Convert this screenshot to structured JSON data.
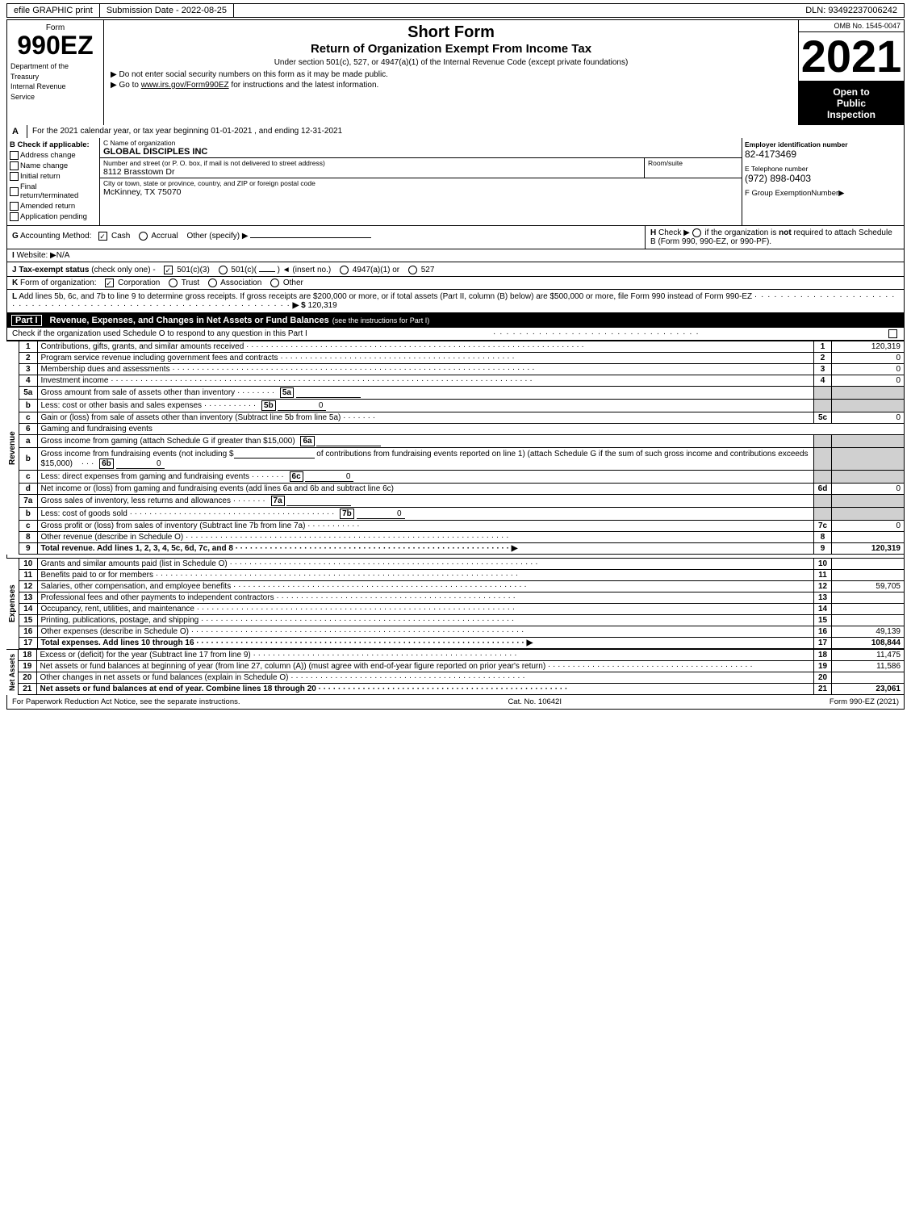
{
  "topBar": {
    "efileLabel": "efile GRAPHIC print",
    "submissionLabel": "Submission Date - 2022-08-25",
    "dlnLabel": "DLN: 93492237006242"
  },
  "header": {
    "formNumber": "990EZ",
    "deptLine1": "Department of the",
    "deptLine2": "Treasury",
    "deptLine3": "Internal Revenue",
    "deptLine4": "Service",
    "titleShortForm": "Short Form",
    "titleReturn": "Return of Organization Exempt From Income Tax",
    "titleUnder": "Under section 501(c), 527, or 4947(a)(1) of the Internal Revenue Code (except private foundations)",
    "noteSSN": "▶ Do not enter social security numbers on this form as it may be made public.",
    "noteGo": "▶ Go to",
    "noteLink": "www.irs.gov/Form990EZ",
    "noteLinkSuffix": "for instructions and the latest information.",
    "ombLabel": "OMB No. 1545-0047",
    "year": "2021",
    "openTitle": "Open to",
    "openPublic": "Public",
    "openInspection": "Inspection"
  },
  "sectionA": {
    "label": "A",
    "text": "For the 2021 calendar year, or tax year beginning 01-01-2021 , and ending 12-31-2021"
  },
  "sectionB": {
    "label": "B",
    "checkLabel": "Check if applicable:",
    "checks": [
      {
        "id": "address",
        "label": "Address change",
        "checked": false
      },
      {
        "id": "name",
        "label": "Name change",
        "checked": false
      },
      {
        "id": "initial",
        "label": "Initial return",
        "checked": false
      },
      {
        "id": "final",
        "label": "Final return/terminated",
        "checked": false
      },
      {
        "id": "amended",
        "label": "Amended return",
        "checked": false
      },
      {
        "id": "pending",
        "label": "Application pending",
        "checked": false
      }
    ]
  },
  "sectionC": {
    "label": "C",
    "nameLabel": "Name of organization",
    "nameValue": "GLOBAL DISCIPLES INC",
    "addressLabel": "Number and street (or P. O. box, if mail is not delivered to street address)",
    "addressValue": "8112 Brasstown Dr",
    "roomLabel": "Room/suite",
    "roomValue": "",
    "cityLabel": "City or town, state or province, country, and ZIP or foreign postal code",
    "cityValue": "McKinney, TX  75070"
  },
  "sectionD": {
    "label": "D",
    "einLabel": "Employer identification number",
    "einValue": "82-4173469",
    "phoneLabel": "E Telephone number",
    "phoneValue": "(972) 898-0403",
    "groupLabel": "F Group Exemption",
    "groupLabel2": "Number",
    "groupArrow": "▶"
  },
  "sectionG": {
    "label": "G",
    "text": "Accounting Method:",
    "cashChecked": true,
    "cashLabel": "Cash",
    "accrualChecked": false,
    "accrualLabel": "Accrual",
    "otherLabel": "Other (specify) ▶",
    "otherValue": ""
  },
  "sectionH": {
    "label": "H",
    "text": "Check ▶",
    "radioLabel": "○ if the organization is",
    "boldText": "not",
    "suffix": "required to attach Schedule B",
    "suffix2": "(Form 990, 990-EZ, or 990-PF)."
  },
  "sectionI": {
    "label": "I",
    "text": "Website: ▶N/A"
  },
  "sectionJ": {
    "label": "J",
    "text": "Tax-exempt status",
    "checkNote": "(check only one) -",
    "option1": "✓ 501(c)(3)",
    "option2": "○ 501(c)(",
    "option2b": ")",
    "option2c": "◄ (insert no.)",
    "option3": "○ 4947(a)(1) or",
    "option4": "○ 527"
  },
  "sectionK": {
    "label": "K",
    "text": "Form of organization:",
    "corpChecked": true,
    "corpLabel": "Corporation",
    "trustChecked": false,
    "trustLabel": "Trust",
    "assocChecked": false,
    "assocLabel": "Association",
    "otherChecked": false,
    "otherLabel": "Other"
  },
  "sectionL": {
    "label": "L",
    "text": "Add lines 5b, 6c, and 7b to line 9 to determine gross receipts. If gross receipts are $200,000 or more, or if total assets (Part II, column (B) below) are $500,000 or more, file Form 990 instead of Form 990-EZ",
    "dots": "· · · · · · · · · · · · · · · · · · · · · · · · · · · · · · · · · · · · · · · · · · · · · · · · · · · · · ·",
    "arrow": "▶ $",
    "value": "120,319"
  },
  "partI": {
    "label": "Part I",
    "title": "Revenue, Expenses, and Changes in Net Assets or Fund Balances",
    "subtitle": "(see the instructions for Part I)",
    "checkNote": "Check if the organization used Schedule O to respond to any question in this Part I",
    "checkDots": "· · · · · · · · · · · · · · · · · · · · · · · · · · · · · ·",
    "rows": [
      {
        "num": "1",
        "desc": "Contributions, gifts, grants, and similar amounts received",
        "dots": true,
        "lineRef": "1",
        "amount": "120,319"
      },
      {
        "num": "2",
        "desc": "Program service revenue including government fees and contracts",
        "dots": true,
        "lineRef": "2",
        "amount": "0"
      },
      {
        "num": "3",
        "desc": "Membership dues and assessments",
        "dots": true,
        "lineRef": "3",
        "amount": "0"
      },
      {
        "num": "4",
        "desc": "Investment income",
        "dots": true,
        "lineRef": "4",
        "amount": "0"
      },
      {
        "num": "5a",
        "desc": "Gross amount from sale of assets other than inventory",
        "hasSub": true,
        "subRef": "5a",
        "subVal": "",
        "lineRef": "",
        "amount": ""
      },
      {
        "num": "5b",
        "isB": true,
        "desc": "Less: cost or other basis and sales expenses",
        "dots": true,
        "subRef": "5b",
        "subVal": "0",
        "lineRef": "",
        "amount": ""
      },
      {
        "num": "5c",
        "isC": true,
        "desc": "Gain or (loss) from sale of assets other than inventory (Subtract line 5b from line 5a)",
        "dots": true,
        "lineRef": "5c",
        "amount": "0"
      },
      {
        "num": "6",
        "desc": "Gaming and fundraising events",
        "lineRef": "",
        "amount": "",
        "isHeader": true
      },
      {
        "num": "6a",
        "isA": true,
        "desc": "Gross income from gaming (attach Schedule G if greater than $15,000)",
        "subRef": "6a",
        "subVal": "",
        "lineRef": "",
        "amount": ""
      },
      {
        "num": "6b",
        "isB": true,
        "desc": "Gross income from fundraising events (not including $",
        "descExtra": "of contributions from fundraising events reported on line 1) (attach Schedule G if the sum of such gross income and contributions exceeds $15,000)",
        "subRef": "6b",
        "subVal": "0",
        "lineRef": "",
        "amount": ""
      },
      {
        "num": "6c",
        "isC": true,
        "desc": "Less: direct expenses from gaming and fundraising events",
        "dots": true,
        "subRef": "6c",
        "subVal": "0",
        "lineRef": "",
        "amount": ""
      },
      {
        "num": "6d",
        "isD": true,
        "desc": "Net income or (loss) from gaming and fundraising events (add lines 6a and 6b and subtract line 6c)",
        "lineRef": "6d",
        "amount": "0"
      },
      {
        "num": "7a",
        "isA": true,
        "desc": "Gross sales of inventory, less returns and allowances",
        "dots": true,
        "subRef": "7a",
        "subVal": "",
        "lineRef": "",
        "amount": ""
      },
      {
        "num": "7b",
        "isB": true,
        "desc": "Less: cost of goods sold",
        "dots": true,
        "subRef": "7b",
        "subVal": "0",
        "lineRef": "",
        "amount": ""
      },
      {
        "num": "7c",
        "isC": true,
        "desc": "Gross profit or (loss) from sales of inventory (Subtract line 7b from line 7a)",
        "dots": true,
        "lineRef": "7c",
        "amount": "0"
      },
      {
        "num": "8",
        "desc": "Other revenue (describe in Schedule O)",
        "dots": true,
        "lineRef": "8",
        "amount": ""
      },
      {
        "num": "9",
        "bold": true,
        "desc": "Total revenue. Add lines 1, 2, 3, 4, 5c, 6d, 7c, and 8",
        "dots": true,
        "arrow": "▶",
        "lineRef": "9",
        "amount": "120,319"
      }
    ],
    "expenseRows": [
      {
        "num": "10",
        "desc": "Grants and similar amounts paid (list in Schedule O)",
        "dots": true,
        "lineRef": "10",
        "amount": ""
      },
      {
        "num": "11",
        "desc": "Benefits paid to or for members",
        "dots": true,
        "lineRef": "11",
        "amount": ""
      },
      {
        "num": "12",
        "desc": "Salaries, other compensation, and employee benefits",
        "dots": true,
        "lineRef": "12",
        "amount": "59,705"
      },
      {
        "num": "13",
        "desc": "Professional fees and other payments to independent contractors",
        "dots": true,
        "lineRef": "13",
        "amount": ""
      },
      {
        "num": "14",
        "desc": "Occupancy, rent, utilities, and maintenance",
        "dots": true,
        "lineRef": "14",
        "amount": ""
      },
      {
        "num": "15",
        "desc": "Printing, publications, postage, and shipping",
        "dots": true,
        "lineRef": "15",
        "amount": ""
      },
      {
        "num": "16",
        "desc": "Other expenses (describe in Schedule O)",
        "dots": true,
        "lineRef": "16",
        "amount": "49,139"
      },
      {
        "num": "17",
        "bold": true,
        "desc": "Total expenses. Add lines 10 through 16",
        "dots": true,
        "arrow": "▶",
        "lineRef": "17",
        "amount": "108,844"
      }
    ],
    "netAssetRows": [
      {
        "num": "18",
        "desc": "Excess or (deficit) for the year (Subtract line 17 from line 9)",
        "dots": true,
        "lineRef": "18",
        "amount": "11,475"
      },
      {
        "num": "19",
        "desc": "Net assets or fund balances at beginning of year (from line 27, column (A)) (must agree with end-of-year figure reported on prior year's return)",
        "dots": true,
        "lineRef": "19",
        "amount": "11,586"
      },
      {
        "num": "20",
        "desc": "Other changes in net assets or fund balances (explain in Schedule O)",
        "dots": true,
        "lineRef": "20",
        "amount": ""
      },
      {
        "num": "21",
        "bold": true,
        "desc": "Net assets or fund balances at end of year. Combine lines 18 through 20",
        "dots": true,
        "lineRef": "21",
        "amount": "23,061"
      }
    ]
  },
  "footer": {
    "left": "For Paperwork Reduction Act Notice, see the separate instructions.",
    "cat": "Cat. No. 10642I",
    "right": "Form 990-EZ (2021)"
  }
}
